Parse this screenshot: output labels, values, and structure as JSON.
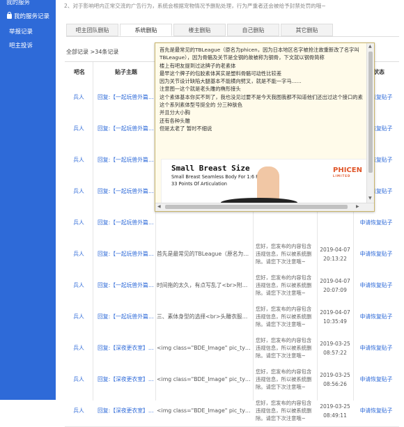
{
  "sidebar": {
    "top_cut": "我的服务",
    "my_records": "我的服务记录",
    "report": "举报记录",
    "complaint": "吧主投诉"
  },
  "notice": "2、对于影响吧内正常交流的广告行为，系统会根据宠物情况予删贴处理，行为严重者还会被给予封禁处罚的哦~",
  "tabs": [
    "吧主团队删贴",
    "系统删贴",
    "楼主删贴",
    "自己删贴",
    "其它删贴"
  ],
  "active_tab": "系统删贴",
  "summary": "全部记录 >34条记录",
  "headers": {
    "author": "吧名",
    "title": "贴子主题",
    "status": "状态"
  },
  "rows": [
    {
      "author": "兵人",
      "title": "回复:【一起玩兽外篇】…",
      "content": "",
      "reason": "",
      "time": "",
      "status": "申请恢复贴子"
    },
    {
      "author": "兵人",
      "title": "回复:【一起玩兽外篇】…",
      "content": "",
      "reason": "",
      "time": "",
      "status": "申请恢复贴子"
    },
    {
      "author": "兵人",
      "title": "回复:【一起玩兽外篇】…",
      "content": "",
      "reason": "",
      "time": "",
      "status": "申请恢复贴子"
    },
    {
      "author": "兵人",
      "title": "回复:【一起玩兽外篇】…",
      "content": "",
      "reason": "",
      "time": "",
      "status": "申请恢复贴子"
    },
    {
      "author": "兵人",
      "title": "回复:【一起玩兽外篇】…",
      "content": "",
      "reason": "",
      "time": "",
      "status": "申请恢复贴子"
    },
    {
      "author": "兵人",
      "title": "回复:【一起玩兽外篇】…",
      "content": "首先是最常见的TBLeague（原名为phicen…",
      "reason": "您好，您发布的内容包含违规信息，所以被系统删除。请您下次注意哦~",
      "time": "2019-04-07 20:13:22",
      "status": "申请恢复贴子"
    },
    {
      "author": "兵人",
      "title": "回复:【一起玩兽外篇】…",
      "content": "时间拖的太久，有点写乱了<br>附了要说…",
      "reason": "您好，您发布的内容包含违规信息，所以被系统删除。请您下次注意哦~",
      "time": "2019-04-07 20:07:09",
      "status": "申请恢复贴子"
    },
    {
      "author": "兵人",
      "title": "回复:【一起玩兽外篇】…",
      "content": "三、素体身型的选择<br>头雕衣服有了，…",
      "reason": "您好，您发布的内容包含违规信息，所以被系统删除。请您下次注意哦~",
      "time": "2019-04-07 10:35:49",
      "status": "申请恢复贴子"
    },
    {
      "author": "兵人",
      "title": "回复:【深夜更衣室】Fir…",
      "content": "<img class=\"BDE_Image\" pic_type=\"0\" w…",
      "reason": "您好，您发布的内容包含违规信息，所以被系统删除。请您下次注意哦~",
      "time": "2019-03-25 08:57:22",
      "status": "申请恢复贴子"
    },
    {
      "author": "兵人",
      "title": "回复:【深夜更衣室】Fir…",
      "content": "<img class=\"BDE_Image\" pic_type=\"0\" w…",
      "reason": "您好，您发布的内容包含违规信息，所以被系统删除。请您下次注意哦~",
      "time": "2019-03-25 08:56:26",
      "status": "申请恢复贴子"
    },
    {
      "author": "兵人",
      "title": "回复:【深夜更衣室】Fir…",
      "content": "<img class=\"BDE_Image\" pic_type=\"0\" w…",
      "reason": "您好，您发布的内容包含违规信息，所以被系统删除。请您下次注意哦~",
      "time": "2019-03-25 08:49:11",
      "status": "申请恢复贴子"
    }
  ],
  "popup": {
    "lines": [
      "首先是最常见的TBLeague（原名为phicen，因为日本地区名字被抢注故重新改了名字叫",
      "TBLeague），因为骨骼及关节是全钢的故被称为钢骨，下文就以钢骨简称",
      "楼上有吧友提到过这牌子的老素体",
      "最早这个牌子的包胶素体其实是塑料骨骼可动性比较差",
      "因为关节设计缺陷大腿基本不能横向劈叉，就是不能一字马......",
      "注意图一这个就是老头雕的椭形接头",
      "这个素体基本你买不到了，我也没见过要不是今天我图我都不知道他们还出过这个接口的素体",
      "这个系列素体型号挺全的 分三种肤色",
      "并且分大小胸",
      "还有各种头雕",
      "但是太老了 暂时不细说"
    ],
    "image": {
      "title": "Small Breast Size",
      "subtitle": "Small Breast Seamless  Body For 1:6 Figure",
      "subtitle2": "33 Points Of Articulation",
      "brand": "PHICEN",
      "brand_sub": "LIMITED"
    }
  }
}
